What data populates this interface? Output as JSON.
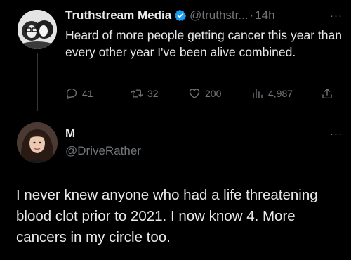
{
  "tweet1": {
    "author_name": "Truthstream Media",
    "handle": "@truthstr...",
    "separator": "·",
    "time": "14h",
    "more": "···",
    "text": "Heard of more people getting cancer this year than every other year I've been alive combined.",
    "verified_color": "#1d9bf0",
    "actions": {
      "replies": "41",
      "retweets": "32",
      "likes": "200",
      "views": "4,987"
    },
    "icons": {
      "reply": "reply-icon",
      "retweet": "retweet-icon",
      "like": "heart-icon",
      "views": "views-bar-chart-icon",
      "share": "share-icon"
    }
  },
  "tweet2": {
    "author_name": "M",
    "handle": "@DriveRather",
    "more": "···",
    "text": "I never knew anyone who had a life threatening blood clot prior to 2021. I now know 4. More cancers in my circle too."
  },
  "colors": {
    "background": "#000000",
    "text": "#e7e9ea",
    "muted": "#71767b",
    "thread_line": "#333639"
  }
}
